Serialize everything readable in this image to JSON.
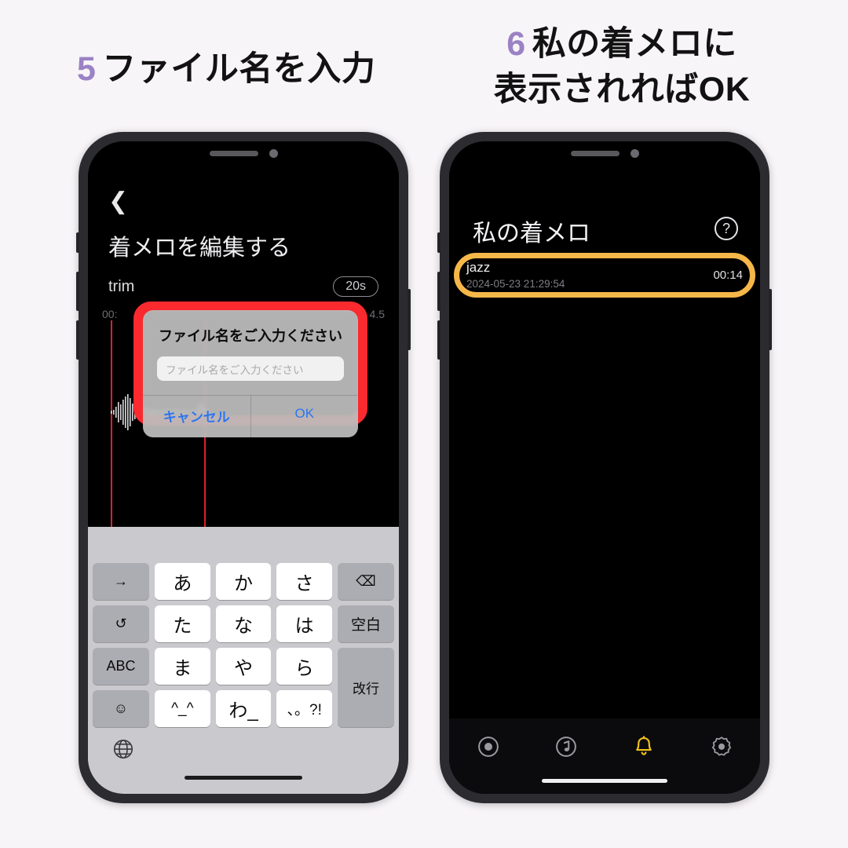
{
  "page": {
    "background_color": "#f8f5f8",
    "accent_purple": "#9b82c4",
    "highlight_red": "#fa2a2f",
    "highlight_orange": "#f6b749"
  },
  "headings": {
    "left": {
      "number": "5",
      "text": "ファイル名を入力"
    },
    "right": {
      "number": "6",
      "line1": "私の着メロに",
      "line2": "表示されればOK"
    }
  },
  "left_phone": {
    "back_icon": "chevron-left-icon",
    "screen_title": "着メロを編集する",
    "trim_label": "trim",
    "duration_badge": "20s",
    "timeline": {
      "start": "00:",
      "end": "4.5"
    },
    "dialog": {
      "title": "ファイル名をご入力ください",
      "input_placeholder": "ファイル名をご入力ください",
      "input_value": "",
      "cancel_label": "キャンセル",
      "ok_label": "OK"
    },
    "keyboard": {
      "rows": [
        [
          "→",
          "あ",
          "か",
          "さ",
          "⌫"
        ],
        [
          "↺",
          "た",
          "な",
          "は",
          "空白"
        ],
        [
          "ABC",
          "ま",
          "や",
          "ら",
          "改行"
        ],
        [
          "☺",
          "^_^",
          "わ_",
          "、。?!"
        ]
      ],
      "globe_icon": "globe-icon"
    }
  },
  "right_phone": {
    "screen_title": "私の着メロ",
    "help_icon_label": "?",
    "list": [
      {
        "name": "jazz",
        "date": "2024-05-23 21:29:54",
        "duration": "00:14"
      }
    ],
    "tabs": [
      {
        "icon": "record-icon",
        "active": false
      },
      {
        "icon": "music-note-icon",
        "active": false
      },
      {
        "icon": "bell-icon",
        "active": true
      },
      {
        "icon": "settings-gear-icon",
        "active": false
      }
    ]
  }
}
